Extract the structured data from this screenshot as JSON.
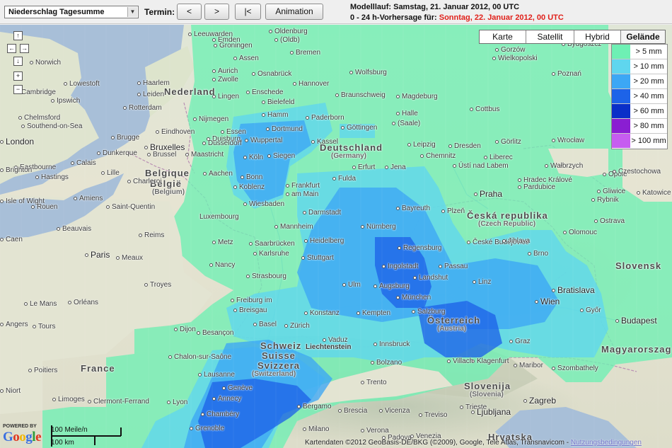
{
  "toolbar": {
    "product_selected": "Niederschlag Tagesumme",
    "termin_label": "Termin:",
    "btn_prev": "<",
    "btn_next": ">",
    "btn_first": "|<",
    "btn_animation": "Animation",
    "model_run": "Modelllauf: Samstag, 21. Januar 2012, 00 UTC",
    "forecast_prefix": "0 - 24 h-Vorhersage für:",
    "forecast_date": "Sonntag, 22. Januar 2012, 00 UTC"
  },
  "map_types": [
    {
      "label": "Karte",
      "active": false
    },
    {
      "label": "Satellit",
      "active": false
    },
    {
      "label": "Hybrid",
      "active": false
    },
    {
      "label": "Gelände",
      "active": true
    }
  ],
  "legend": [
    {
      "label": "> 5 mm",
      "color": "#6ef0b4"
    },
    {
      "label": "> 10 mm",
      "color": "#5fd6ee"
    },
    {
      "label": "> 20 mm",
      "color": "#3ca7f5"
    },
    {
      "label": "> 40 mm",
      "color": "#1d63e8"
    },
    {
      "label": "> 60 mm",
      "color": "#0a2fc8"
    },
    {
      "label": "> 80 mm",
      "color": "#8a1ed2"
    },
    {
      "label": "> 100 mm",
      "color": "#c65df0"
    }
  ],
  "controls": {
    "up": "↑",
    "left": "←",
    "right": "→",
    "down": "↓",
    "zoom_in": "+",
    "zoom_out": "−"
  },
  "scale": {
    "miles": "100 Meile/n",
    "km": "100 km"
  },
  "powered_by": "POWERED BY",
  "google_logo": "Google",
  "attribution": "Kartendaten ©2012 GeoBasis-DE/BKG (©2009), Google, Tele Atlas, Transnavicom -",
  "terms_link": "Nutzungsbedingungen",
  "map_labels": {
    "countries": {
      "nederland": "Nederland",
      "belgique": "Belgique",
      "belgie": "België",
      "belgium": "(Belgium)",
      "deutschland": "Deutschland",
      "germany": "(Germany)",
      "ceska": "Česká republika",
      "czech": "(Czech Republic)",
      "schweiz": "Schweiz",
      "suisse": "Suisse",
      "svizzera": "Svizzera",
      "switzerland": "(Switzerland)",
      "oesterreich": "Österreich",
      "austria": "(Austria)",
      "france": "France",
      "slovenija": "Slovenija",
      "slovenia": "(Slovenia)",
      "magyarorszag": "Magyarorszag",
      "hrvatska": "Hrvatska",
      "slovensko": "Slovensk",
      "luxembourg": "Luxembourg",
      "liechtenstein": "Liechtenstein"
    },
    "cities": {
      "norwich": "Norwich",
      "lowestoft": "Lowestoft",
      "cambridge": "Cambridge",
      "ipswich": "Ipswich",
      "chelmsford": "Chelmsford",
      "southend": "Southend-on-Sea",
      "london": "London",
      "eastbourne": "Eastbourne",
      "brighton": "Brighton",
      "hastings": "Hastings",
      "isle": "Isle of Wight",
      "haarlem": "Haarlem",
      "leiden": "Leiden",
      "rotterdam": "Rotterdam",
      "nijmegen": "Nijmegen",
      "eindhoven": "Eindhoven",
      "brugge": "Brugge",
      "dunkerque": "Dunkerque",
      "calais": "Calais",
      "lille": "Lille",
      "bruxelles": "Bruxelles",
      "brussel": "Brussel",
      "maastricht": "Maastricht",
      "aachen": "Aachen",
      "charleroi": "Charleroi",
      "saint_quentin": "Saint-Quentin",
      "amiens": "Amiens",
      "rouen": "Rouen",
      "beauvais": "Beauvais",
      "caen": "Caen",
      "reims": "Reims",
      "paris": "Paris",
      "meaux": "Meaux",
      "metz": "Metz",
      "nancy": "Nancy",
      "troyes": "Troyes",
      "le_mans": "Le Mans",
      "orleans": "Orléans",
      "tours": "Tours",
      "angers": "Angers",
      "dijon": "Dijon",
      "besancon": "Besançon",
      "poitiers": "Poitiers",
      "niort": "Niort",
      "limoges": "Limoges",
      "clermont": "Clermont-Ferrand",
      "lyon": "Lyon",
      "grenoble": "Grenoble",
      "chambery": "Chambéry",
      "annecy": "Annecy",
      "geneve": "Genève",
      "lausanne": "Lausanne",
      "chalon": "Chalon-sur-Saône",
      "emden": "Emden",
      "oldenburg": "Oldenburg",
      "oldb": "(Oldb)",
      "bremen": "Bremen",
      "groningen": "Groningen",
      "leeuwarden": "Leeuwarden",
      "assen": "Assen",
      "zwolle": "Zwolle",
      "enschede": "Enschede",
      "bielefeld": "Bielefeld",
      "hamm": "Hamm",
      "dortmund": "Dortmund",
      "essen": "Essen",
      "duisburg": "Duisburg",
      "dusseldorf": "Düsseldorf",
      "wuppertal": "Wuppertal",
      "koln": "Köln",
      "siegen": "Siegen",
      "bonn": "Bonn",
      "koblenz": "Koblenz",
      "paderborn": "Paderborn",
      "osnabruck": "Osnabrück",
      "hannover": "Hannover",
      "wolfsburg": "Wolfsburg",
      "braunschweig": "Braunschweig",
      "magdeburg": "Magdeburg",
      "gottingen": "Göttingen",
      "halle": "Halle",
      "saale": "(Saale)",
      "leipzig": "Leipzig",
      "dresden": "Dresden",
      "chemnitz": "Chemnitz",
      "jena": "Jena",
      "erfurt": "Erfurt",
      "kassel": "Kassel",
      "fulda": "Fulda",
      "frankfurt": "Frankfurt",
      "am_main": "am Main",
      "wiesbaden": "Wiesbaden",
      "darmstadt": "Darmstadt",
      "mannheim": "Mannheim",
      "heidelberg": "Heidelberg",
      "karlsruhe": "Karlsruhe",
      "saarbrucken": "Saarbrücken",
      "stuttgart": "Stuttgart",
      "nurnberg": "Nürnberg",
      "bayreuth": "Bayreuth",
      "regensburg": "Regensburg",
      "ingolstadt": "Ingolstadt",
      "augsburg": "Augsburg",
      "munchen": "München",
      "ulm": "Ulm",
      "landshut": "Landshut",
      "passau": "Passau",
      "strasbourg": "Strasbourg",
      "freiburg": "Freiburg im",
      "breisgau": "Breisgau",
      "basel": "Basel",
      "zurich": "Zürich",
      "konstanz": "Konstanz",
      "kempten": "Kempten",
      "vaduz": "Vaduz",
      "innsbruck": "Innsbruck",
      "salzburg": "Salzburg",
      "linz": "Linz",
      "wien": "Wien",
      "graz": "Graz",
      "klagenfurt": "Klagenfurt",
      "villach": "Villach",
      "bolzano": "Bolzano",
      "trento": "Trento",
      "bergamo": "Bergamo",
      "brescia": "Brescia",
      "milano": "Milano",
      "verona": "Verona",
      "vicenza": "Vicenza",
      "padova": "Padova",
      "venezia": "Venezia",
      "treviso": "Treviso",
      "trieste": "Trieste",
      "ljubljana": "Ljubljana",
      "maribor": "Maribor",
      "zagreb": "Zagreb",
      "praha": "Praha",
      "plzen": "Plzeň",
      "ceske_budejovice": "České Budějovice",
      "brno": "Brno",
      "olomouc": "Olomouc",
      "ostrava": "Ostrava",
      "pardubice": "Pardubice",
      "hradec": "Hradec Králové",
      "liberec": "Liberec",
      "usti": "Ústí nad Labem",
      "jihlava": "Jihlava",
      "bratislava": "Bratislava",
      "gyor": "Győr",
      "budapest": "Budapest",
      "szombathely": "Szombathely",
      "poznan": "Poznań",
      "wroclaw": "Wrocław",
      "opole": "Opole",
      "katowice": "Katowice",
      "walbrzych": "Wałbrzych",
      "gorlitz": "Görlitz",
      "cottbus": "Cottbus",
      "gorzow": "Gorzów",
      "wielkopolski": "Wielkopolski",
      "bydgoszcz": "Bydgoszcz",
      "czestochowa": "Czestochowa",
      "gliwice": "Gliwice",
      "rybnik": "Rybnik",
      "lingen": "Lingen",
      "aurich": "Aurich"
    }
  }
}
